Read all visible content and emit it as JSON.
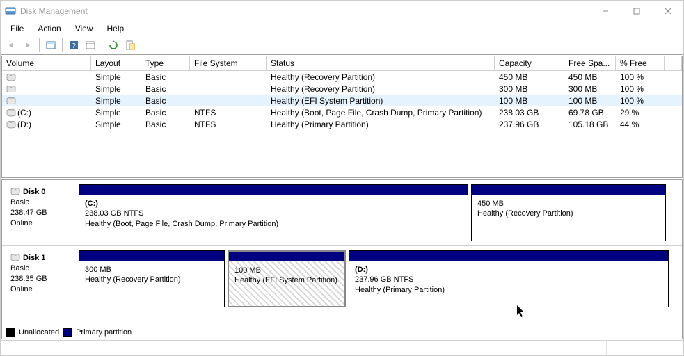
{
  "window": {
    "title": "Disk Management"
  },
  "menu": [
    "File",
    "Action",
    "View",
    "Help"
  ],
  "columns": {
    "volume": "Volume",
    "layout": "Layout",
    "type": "Type",
    "fs": "File System",
    "status": "Status",
    "capacity": "Capacity",
    "free": "Free Spa...",
    "pfree": "% Free"
  },
  "volumes": [
    {
      "name": "",
      "layout": "Simple",
      "type": "Basic",
      "fs": "",
      "status": "Healthy (Recovery Partition)",
      "capacity": "450 MB",
      "free": "450 MB",
      "pfree": "100 %"
    },
    {
      "name": "",
      "layout": "Simple",
      "type": "Basic",
      "fs": "",
      "status": "Healthy (Recovery Partition)",
      "capacity": "300 MB",
      "free": "300 MB",
      "pfree": "100 %"
    },
    {
      "name": "",
      "layout": "Simple",
      "type": "Basic",
      "fs": "",
      "status": "Healthy (EFI System Partition)",
      "capacity": "100 MB",
      "free": "100 MB",
      "pfree": "100 %",
      "selected": true
    },
    {
      "name": "(C:)",
      "layout": "Simple",
      "type": "Basic",
      "fs": "NTFS",
      "status": "Healthy (Boot, Page File, Crash Dump, Primary Partition)",
      "capacity": "238.03 GB",
      "free": "69.78 GB",
      "pfree": "29 %"
    },
    {
      "name": "(D:)",
      "layout": "Simple",
      "type": "Basic",
      "fs": "NTFS",
      "status": "Healthy (Primary Partition)",
      "capacity": "237.96 GB",
      "free": "105.18 GB",
      "pfree": "44 %"
    }
  ],
  "disks": [
    {
      "name": "Disk 0",
      "type": "Basic",
      "size": "238.47 GB",
      "state": "Online",
      "parts": [
        {
          "title": "(C:)",
          "line2": "238.03 GB NTFS",
          "line3": "Healthy (Boot, Page File, Crash Dump, Primary Partition)",
          "flex": 560,
          "kind": "primary"
        },
        {
          "title": "",
          "line2": "450 MB",
          "line3": "Healthy (Recovery Partition)",
          "flex": 280,
          "kind": "primary"
        }
      ]
    },
    {
      "name": "Disk 1",
      "type": "Basic",
      "size": "238.35 GB",
      "state": "Online",
      "parts": [
        {
          "title": "",
          "line2": "300 MB",
          "line3": "Healthy (Recovery Partition)",
          "flex": 210,
          "kind": "primary"
        },
        {
          "title": "",
          "line2": "100 MB",
          "line3": "Healthy (EFI System Partition)",
          "flex": 170,
          "kind": "efi"
        },
        {
          "title": "(D:)",
          "line2": "237.96 GB NTFS",
          "line3": "Healthy (Primary Partition)",
          "flex": 460,
          "kind": "primary"
        }
      ]
    }
  ],
  "legend": {
    "unallocated": "Unallocated",
    "primary": "Primary partition"
  },
  "toolbar_icons": [
    "back-arrow-icon",
    "forward-arrow-icon",
    "browse-icon",
    "help-icon",
    "window-icon",
    "refresh-icon",
    "properties-icon"
  ]
}
